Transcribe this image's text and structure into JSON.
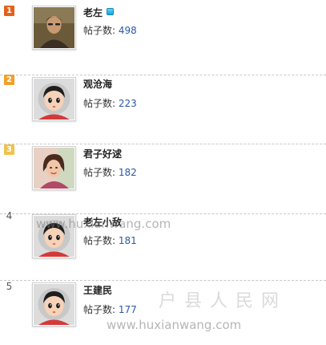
{
  "ranking": {
    "count_label": "帖子数:",
    "items": [
      {
        "rank": "1",
        "name": "老左",
        "posts": "498",
        "avatar": "photo-man-icon",
        "badge": true
      },
      {
        "rank": "2",
        "name": "观沧海",
        "posts": "223",
        "avatar": "default-cartoon-avatar-icon",
        "badge": false
      },
      {
        "rank": "3",
        "name": "君子好逑",
        "posts": "182",
        "avatar": "photo-woman-icon",
        "badge": false
      },
      {
        "rank": "4",
        "name": "老左小敌",
        "posts": "181",
        "avatar": "default-cartoon-avatar-icon",
        "badge": false
      },
      {
        "rank": "5",
        "name": "王建民",
        "posts": "177",
        "avatar": "default-cartoon-avatar-icon",
        "badge": false
      }
    ]
  },
  "watermark": {
    "url": "www.huxianwang.com",
    "site_name": "户县人民网"
  },
  "colors": {
    "rank1": "#e2621b",
    "rank2": "#f1a12b",
    "rank3": "#f0c24a",
    "post_count": "#2a5aa6",
    "badge": "#1aa0d8"
  }
}
